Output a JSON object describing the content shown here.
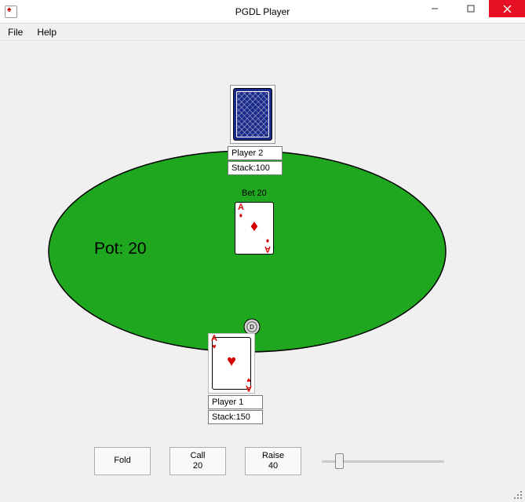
{
  "window": {
    "title": "PGDL Player"
  },
  "menu": {
    "file": "File",
    "help": "Help"
  },
  "table": {
    "pot_label": "Pot: 20",
    "bet_label": "Bet 20"
  },
  "players": {
    "top": {
      "name": "Player 2",
      "stack": "Stack:100",
      "card_face_down": true
    },
    "bottom": {
      "name": "Player 1",
      "stack": "Stack:150",
      "card": {
        "rank": "A",
        "suit": "♥",
        "color": "red"
      }
    }
  },
  "community_card": {
    "rank": "A",
    "suit": "♦",
    "color": "red"
  },
  "dealer_button": "D",
  "actions": {
    "fold": {
      "label": "Fold"
    },
    "call": {
      "label": "Call",
      "amount": "20"
    },
    "raise": {
      "label": "Raise",
      "amount": "40"
    }
  },
  "slider": {
    "min": 0,
    "max": 100,
    "value": 12
  }
}
